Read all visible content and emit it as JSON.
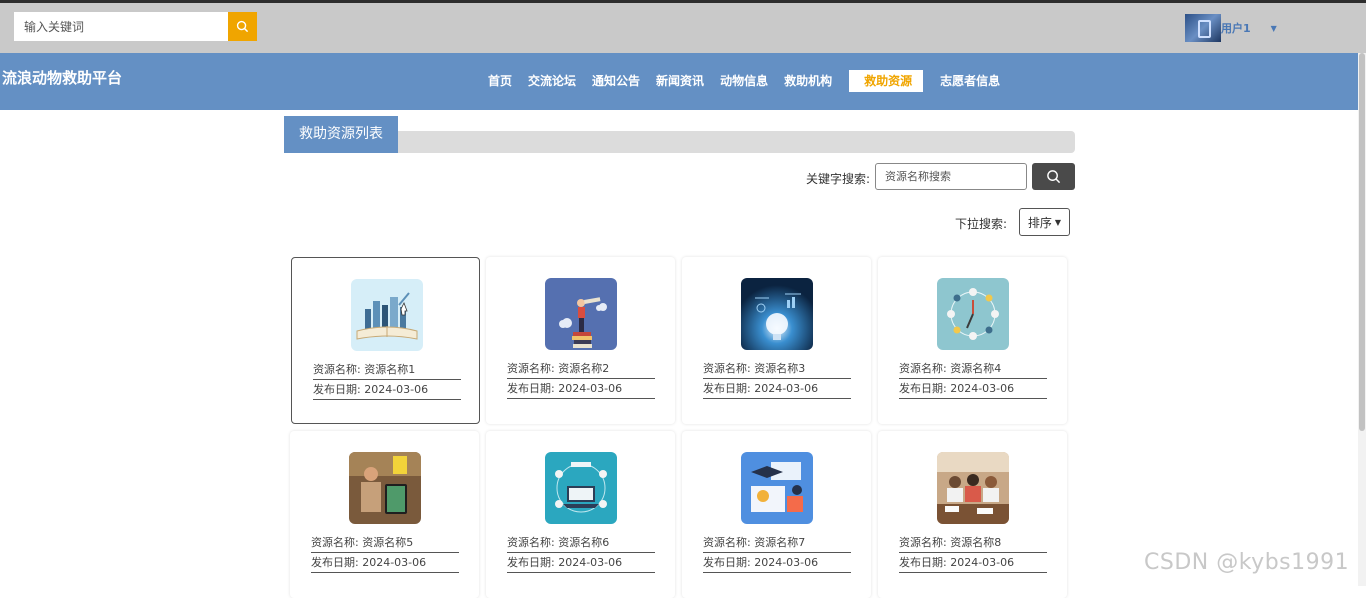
{
  "topbar": {
    "search_placeholder": "输入关键词",
    "user_name": "用户1",
    "colors": {
      "accent": "#f0a500",
      "topbar_bg": "#c9c9c9"
    }
  },
  "navbar": {
    "brand": "流浪动物救助平台",
    "items": [
      {
        "label": "首页",
        "active": false
      },
      {
        "label": "交流论坛",
        "active": false
      },
      {
        "label": "通知公告",
        "active": false
      },
      {
        "label": "新闻资讯",
        "active": false
      },
      {
        "label": "动物信息",
        "active": false
      },
      {
        "label": "救助机构",
        "active": false
      },
      {
        "label": "救助资源",
        "active": true
      },
      {
        "label": "志愿者信息",
        "active": false
      }
    ],
    "color": "#6490c4"
  },
  "section": {
    "title": "救助资源列表"
  },
  "filters": {
    "keyword_label": "关键字搜索:",
    "keyword_placeholder": "资源名称搜索",
    "dropdown_label": "下拉搜索:",
    "sort_label": "排序"
  },
  "cards": [
    {
      "name_label": "资源名称:",
      "name": "资源名称1",
      "date_label": "发布日期:",
      "date": "2024-03-06",
      "image": "book-city-image"
    },
    {
      "name_label": "资源名称:",
      "name": "资源名称2",
      "date_label": "发布日期:",
      "date": "2024-03-06",
      "image": "telescope-books-image"
    },
    {
      "name_label": "资源名称:",
      "name": "资源名称3",
      "date_label": "发布日期:",
      "date": "2024-03-06",
      "image": "lightbulb-image"
    },
    {
      "name_label": "资源名称:",
      "name": "资源名称4",
      "date_label": "发布日期:",
      "date": "2024-03-06",
      "image": "clock-icons-image"
    },
    {
      "name_label": "资源名称:",
      "name": "资源名称5",
      "date_label": "发布日期:",
      "date": "2024-03-06",
      "image": "classroom-tablet-image"
    },
    {
      "name_label": "资源名称:",
      "name": "资源名称6",
      "date_label": "发布日期:",
      "date": "2024-03-06",
      "image": "laptop-education-image"
    },
    {
      "name_label": "资源名称:",
      "name": "资源名称7",
      "date_label": "发布日期:",
      "date": "2024-03-06",
      "image": "graduation-study-image"
    },
    {
      "name_label": "资源名称:",
      "name": "资源名称8",
      "date_label": "发布日期:",
      "date": "2024-03-06",
      "image": "students-exam-image"
    }
  ],
  "watermark": "CSDN @kybs1991"
}
